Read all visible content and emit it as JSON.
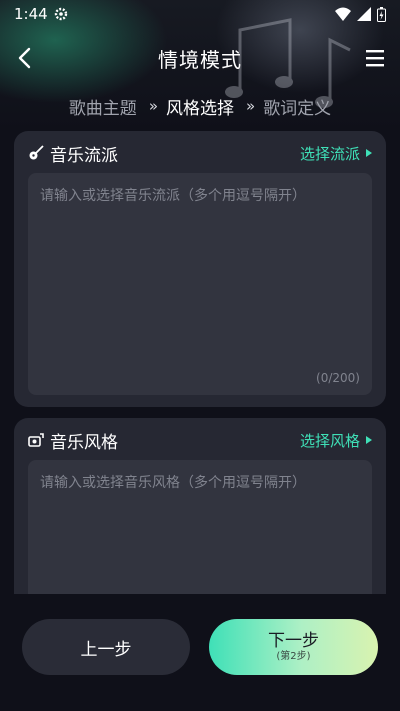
{
  "status_bar": {
    "time": "1:44"
  },
  "header": {
    "title": "情境模式"
  },
  "steps": [
    {
      "label": "歌曲主题"
    },
    {
      "label": "风格选择"
    },
    {
      "label": "歌词定义"
    }
  ],
  "step_separator": "»",
  "cards": {
    "genre": {
      "title": "音乐流派",
      "action_label": "选择流派",
      "placeholder": "请输入或选择音乐流派（多个用逗号隔开）",
      "counter": "(0/200)"
    },
    "style": {
      "title": "音乐风格",
      "action_label": "选择风格",
      "placeholder": "请输入或选择音乐风格（多个用逗号隔开）"
    }
  },
  "footer": {
    "prev_label": "上一步",
    "next_label": "下一步",
    "next_sub": "(第2步)"
  },
  "colors": {
    "accent": "#3fe0b7",
    "background": "#0f1019",
    "card": "#262833"
  }
}
